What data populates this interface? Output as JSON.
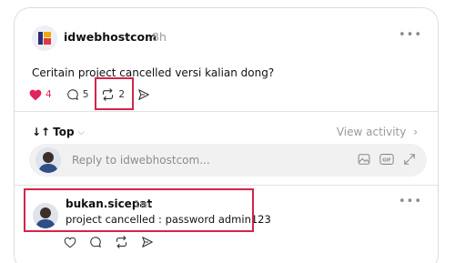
{
  "post": {
    "author": "idwebhostcom",
    "time": "8h",
    "text": "Ceritain project cancelled versi kalian dong?",
    "likes": "4",
    "replies": "5",
    "reposts": "2",
    "avatar_icon": "idwebhost-logo",
    "more_icon": "more-icon",
    "highlight_color": "#d4244a",
    "like_color": "#e0245e"
  },
  "thread": {
    "sort_label": "Top",
    "sort_icon": "sort-arrows-icon",
    "view_activity": "View activity",
    "reply_placeholder": "Reply to idwebhostcom..."
  },
  "comment": {
    "author": "bukan.sicepat",
    "time": "1m",
    "text": "project cancelled : password admin123"
  }
}
